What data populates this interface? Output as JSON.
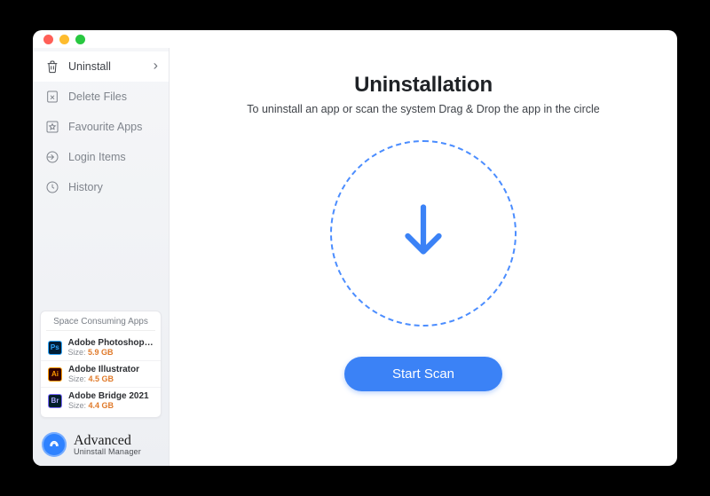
{
  "sidebar": {
    "items": [
      {
        "label": "Uninstall"
      },
      {
        "label": "Delete Files"
      },
      {
        "label": "Favourite Apps"
      },
      {
        "label": "Login Items"
      },
      {
        "label": "History"
      }
    ]
  },
  "spaceCard": {
    "title": "Space Consuming Apps",
    "sizeLabel": "Size:",
    "apps": [
      {
        "name": "Adobe Photoshop 2...",
        "size": "5.9 GB",
        "badge": "Ps"
      },
      {
        "name": "Adobe Illustrator",
        "size": "4.5 GB",
        "badge": "Ai"
      },
      {
        "name": "Adobe Bridge 2021",
        "size": "4.4 GB",
        "badge": "Br"
      }
    ]
  },
  "brand": {
    "top": "Advanced",
    "bottom": "Uninstall Manager"
  },
  "main": {
    "title": "Uninstallation",
    "subtitle": "To uninstall an app or scan the system Drag & Drop the app in the circle",
    "startButton": "Start Scan"
  }
}
